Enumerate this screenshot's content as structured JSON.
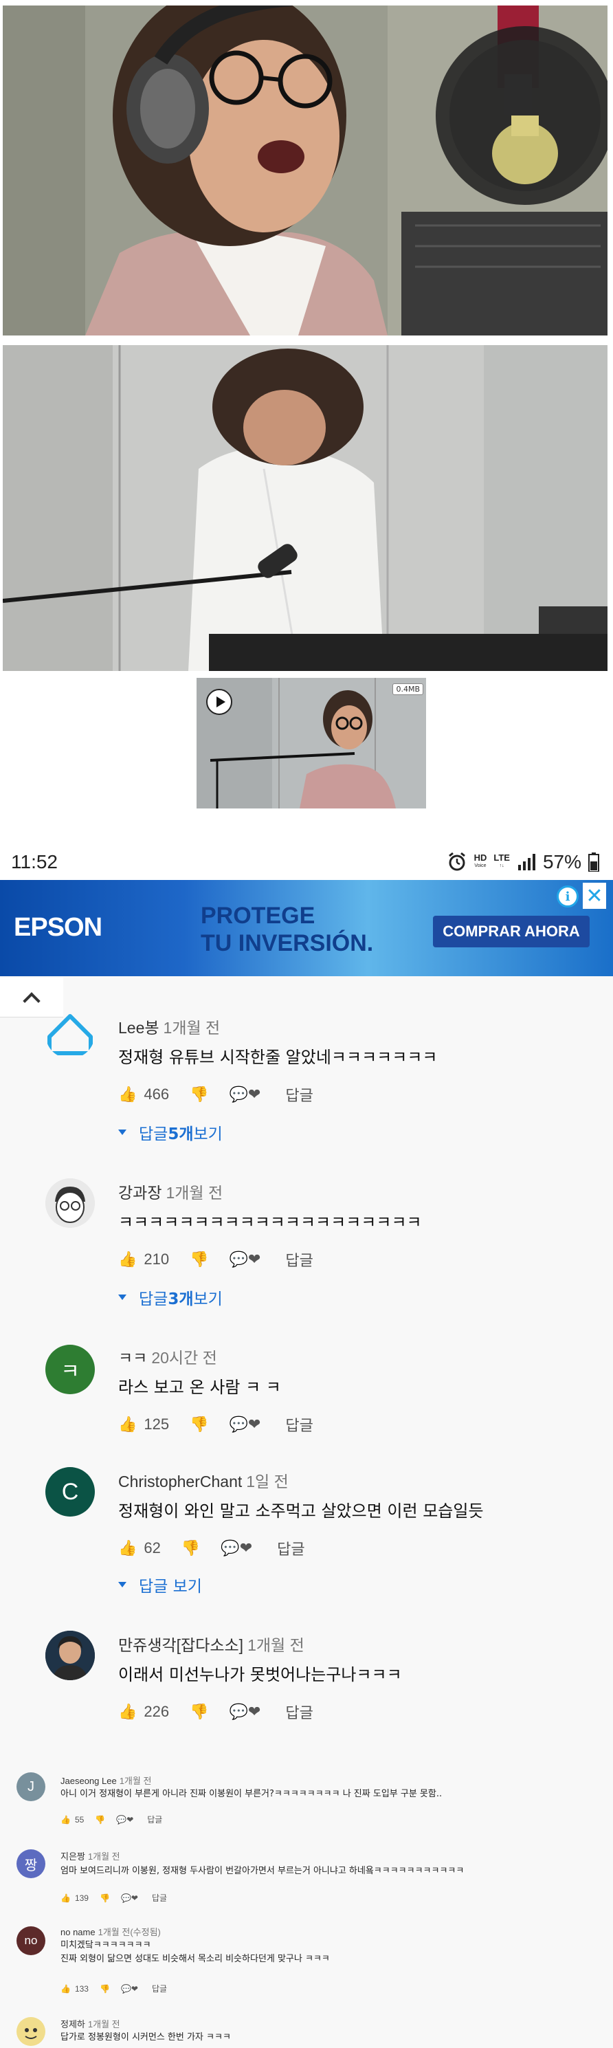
{
  "media": {
    "gif_size_badge": "0.4MB"
  },
  "status_bar": {
    "time": "11:52",
    "hd": "HD",
    "hd_sub": "Voice",
    "lte": "LTE",
    "battery": "57%"
  },
  "ad": {
    "brand": "EPSON",
    "headline_line1": "PROTEGE",
    "headline_line2": "TU INVERSIÓN.",
    "cta": "COMPRAR AHORA",
    "info_symbol": "i",
    "close_symbol": "✕"
  },
  "comments": [
    {
      "author": "Lee봉",
      "ago": "1개월 전",
      "text": "정재형 유튜브 시작한줄 알았네ㅋㅋㅋㅋㅋㅋㅋ",
      "likes": "466",
      "reply_label": "답글",
      "view_replies_prefix": "답글 ",
      "view_replies_count": "5개",
      "view_replies_suffix": " 보기"
    },
    {
      "author": "강과장",
      "ago": "1개월 전",
      "text": "ㅋㅋㅋㅋㅋㅋㅋㅋㅋㅋㅋㅋㅋㅋㅋㅋㅋㅋㅋㅋ",
      "likes": "210",
      "reply_label": "답글",
      "view_replies_prefix": "답글 ",
      "view_replies_count": "3개",
      "view_replies_suffix": " 보기"
    },
    {
      "author": "ㅋㅋ",
      "ago": "20시간 전",
      "avatar_letter": "ㅋ",
      "text": "라스 보고 온 사람 ㅋ ㅋ",
      "likes": "125",
      "reply_label": "답글"
    },
    {
      "author": "ChristopherChant",
      "ago": "1일 전",
      "avatar_letter": "C",
      "text": "정재형이 와인 말고 소주먹고 살았으면 이런 모습일듯",
      "likes": "62",
      "reply_label": "답글",
      "view_replies_text": "답글 보기"
    },
    {
      "author": "만쥬생각[잡다소소]",
      "ago": "1개월 전",
      "text": "이래서 미선누나가 못벗어나는구나ㅋㅋㅋ",
      "likes": "226",
      "reply_label": "답글"
    }
  ],
  "small_comments": [
    {
      "author": "Jaeseong Lee",
      "ago": "1개월 전",
      "avatar_letter": "J",
      "text": "아니 이거 정재형이 부른게 아니라 진짜 이봉원이 부른거?ㅋㅋㅋㅋㅋㅋㅋㅋ 나 진짜 도입부 구분 못함..",
      "likes": "55",
      "reply_label": "답글"
    },
    {
      "author": "지은짱",
      "ago": "1개월 전",
      "avatar_letter": "짱",
      "text": "엄마 보여드리니까 이봉원, 정재형 두사람이 번갈아가면서 부르는거 아니냐고 하네욬ㅋㅋㅋㅋㅋㅋㅋㅋㅋㅋㅋ",
      "likes": "139",
      "reply_label": "답글"
    },
    {
      "author": "no name",
      "ago": "1개월 전(수정됨)",
      "avatar_letter": "no",
      "text_line1": "미치겠닼ㅋㅋㅋㅋㅋㅋㅋ",
      "text_line2": "진짜 외형이 닮으면 성대도 비슷해서 목소리 비슷하다던게 맞구나 ㅋㅋㅋ",
      "likes": "133",
      "reply_label": "답글"
    },
    {
      "author": "정제하",
      "ago": "1개월 전",
      "text": "답가로 정봉원형이 시커먼스 한번 가자 ㅋㅋㅋ"
    }
  ]
}
